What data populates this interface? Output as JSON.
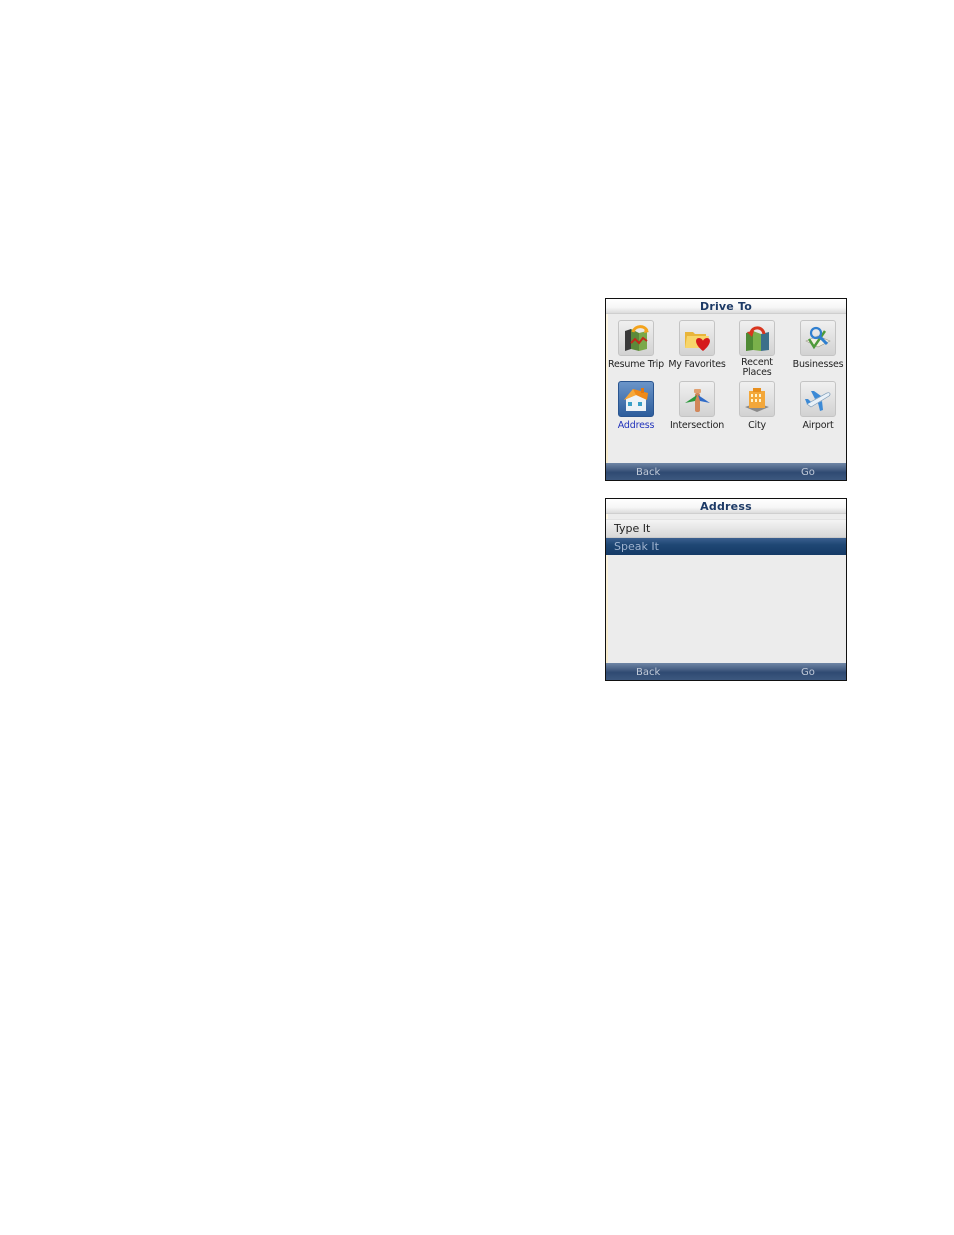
{
  "drive_to_screen": {
    "title": "Drive To",
    "items": [
      {
        "label": "Resume Trip",
        "icon": "resume-trip-icon",
        "selected": false
      },
      {
        "label": "My Favorites",
        "icon": "favorites-folder-icon",
        "selected": false
      },
      {
        "label_line1": "Recent",
        "label_line2": "Places",
        "icon": "recent-places-icon",
        "selected": false
      },
      {
        "label": "Businesses",
        "icon": "businesses-search-icon",
        "selected": false
      },
      {
        "label": "Address",
        "icon": "house-icon",
        "selected": true
      },
      {
        "label": "Intersection",
        "icon": "intersection-sign-icon",
        "selected": false
      },
      {
        "label": "City",
        "icon": "city-building-icon",
        "selected": false
      },
      {
        "label": "Airport",
        "icon": "airplane-icon",
        "selected": false
      }
    ],
    "softkeys": {
      "left": "Back",
      "right": "Go"
    }
  },
  "address_screen": {
    "title": "Address",
    "items": [
      {
        "label": "Type It",
        "selected": false
      },
      {
        "label": "Speak It",
        "selected": true
      }
    ],
    "softkeys": {
      "left": "Back",
      "right": "Go"
    }
  },
  "colors": {
    "title_text": "#1d3a66",
    "selected_label": "#2233bb",
    "softkey_bar": "#3d587f",
    "highlight_row": "#1f4774"
  }
}
